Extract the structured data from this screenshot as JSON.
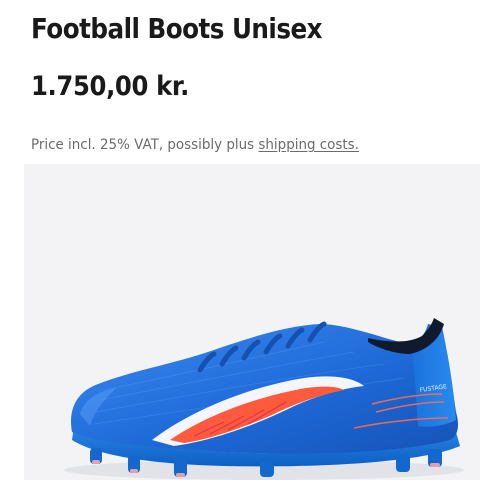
{
  "product": {
    "title": "Football Boots Unisex",
    "price": "1.750,00 kr.",
    "vat_prefix": "Price incl. 25% VAT, possibly plus ",
    "shipping_link": "shipping costs."
  },
  "image": {
    "alt": "Blue football boot with white and orange stripe",
    "brand_print": "FUSTAGE",
    "colors": {
      "background": "#f3f3f5",
      "boot_blue": "#1f6fd6",
      "stripe": "#ff5a3c"
    }
  }
}
